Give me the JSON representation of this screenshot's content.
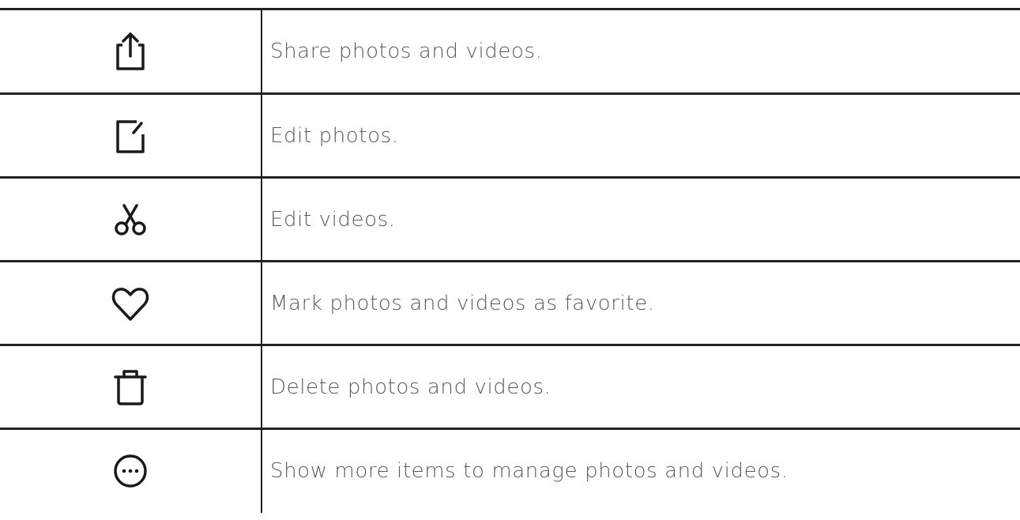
{
  "rows": [
    {
      "icon": "share-icon",
      "description": "Share photos and videos."
    },
    {
      "icon": "edit-photo-icon",
      "description": "Edit photos."
    },
    {
      "icon": "scissors-icon",
      "description": "Edit videos."
    },
    {
      "icon": "heart-icon",
      "description": "Mark photos and videos as favorite."
    },
    {
      "icon": "trash-icon",
      "description": "Delete photos and videos."
    },
    {
      "icon": "more-icon",
      "description": "Show more items to manage photos and videos."
    }
  ],
  "colors": {
    "icon": "#1a1a1a",
    "text": "#5a5a5a",
    "border": "#222222"
  }
}
